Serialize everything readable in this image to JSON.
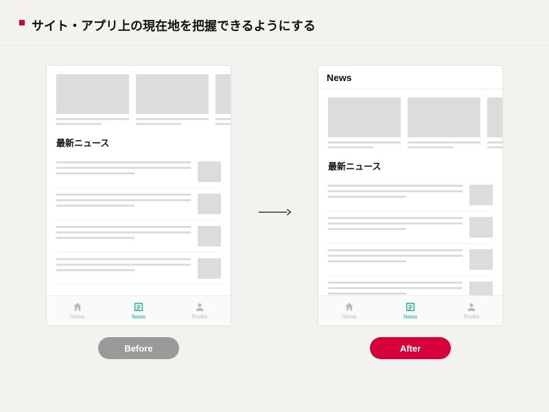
{
  "heading": "サイト・アプリ上の現在地を把握できるようにする",
  "arrow_name": "arrow-right-icon",
  "before": {
    "label": "Before",
    "section_title": "最新ニュース",
    "tabs": [
      {
        "label": "Home",
        "active": false,
        "icon": "home-icon"
      },
      {
        "label": "News",
        "active": true,
        "icon": "news-icon"
      },
      {
        "label": "Profile",
        "active": false,
        "icon": "profile-icon"
      }
    ]
  },
  "after": {
    "label": "After",
    "titlebar": "News",
    "section_title": "最新ニュース",
    "tabs": [
      {
        "label": "Home",
        "active": false,
        "icon": "home-icon"
      },
      {
        "label": "News",
        "active": true,
        "icon": "news-icon"
      },
      {
        "label": "Profile",
        "active": false,
        "icon": "profile-icon"
      }
    ]
  }
}
